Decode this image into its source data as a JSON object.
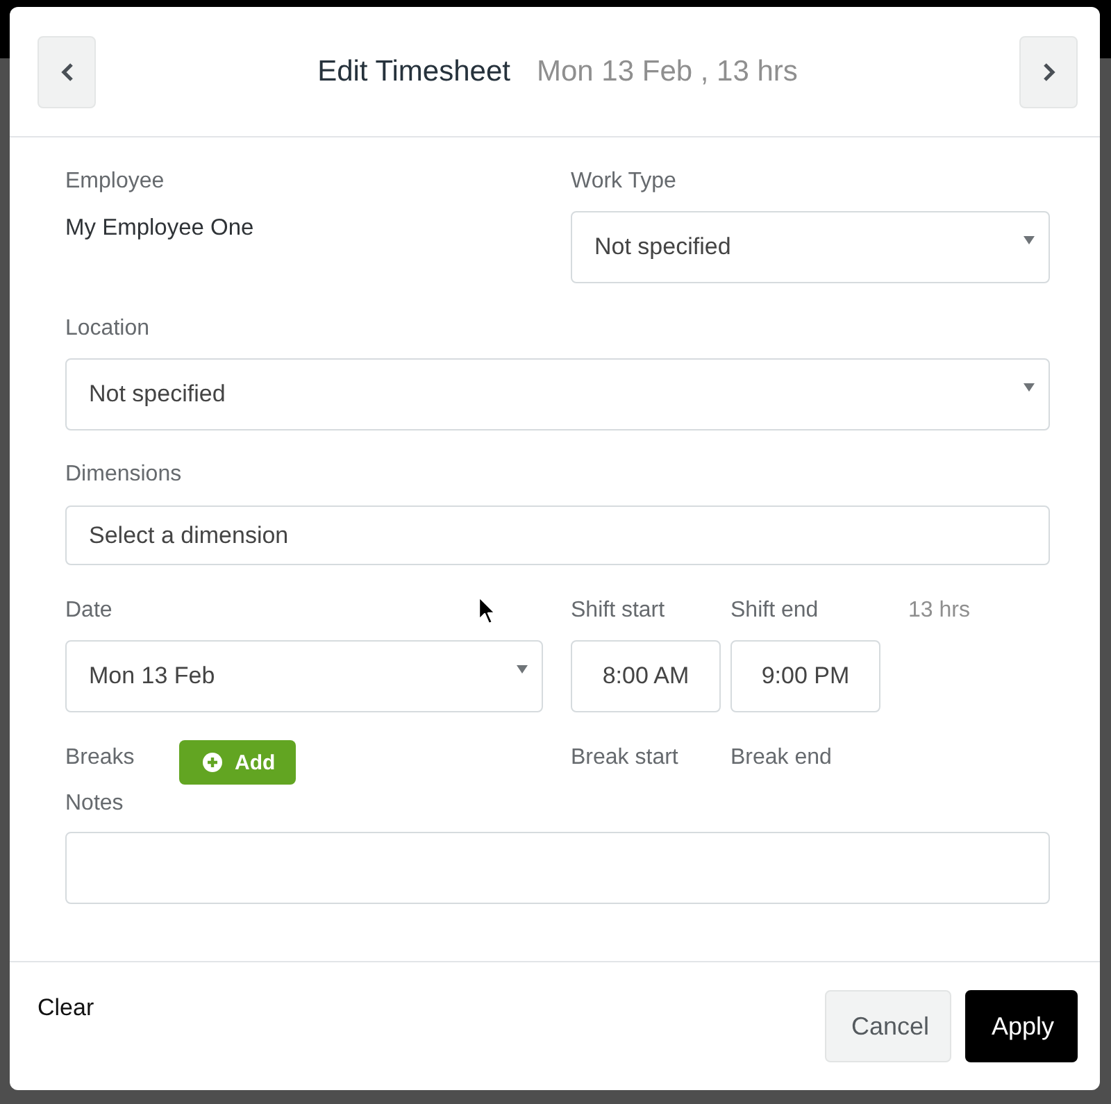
{
  "dialog": {
    "title": "Edit Timesheet",
    "subtitle": "Mon 13 Feb , 13 hrs"
  },
  "employee": {
    "label": "Employee",
    "value": "My Employee One"
  },
  "work_type": {
    "label": "Work Type",
    "value": "Not specified"
  },
  "location": {
    "label": "Location",
    "value": "Not specified"
  },
  "dimensions": {
    "label": "Dimensions",
    "placeholder": "Select a dimension"
  },
  "date": {
    "label": "Date",
    "value": "Mon 13 Feb"
  },
  "shift": {
    "start_label": "Shift start",
    "start": "8:00 AM",
    "end_label": "Shift end",
    "end": "9:00 PM",
    "duration": "13 hrs"
  },
  "breaks": {
    "label": "Breaks",
    "add_button": "Add",
    "start_label": "Break start",
    "end_label": "Break end"
  },
  "notes": {
    "label": "Notes"
  },
  "footer": {
    "clear": "Clear",
    "buttons": [
      {
        "label": "Cancel",
        "kind": "secondary"
      },
      {
        "label": "Apply",
        "kind": "primary"
      }
    ]
  }
}
